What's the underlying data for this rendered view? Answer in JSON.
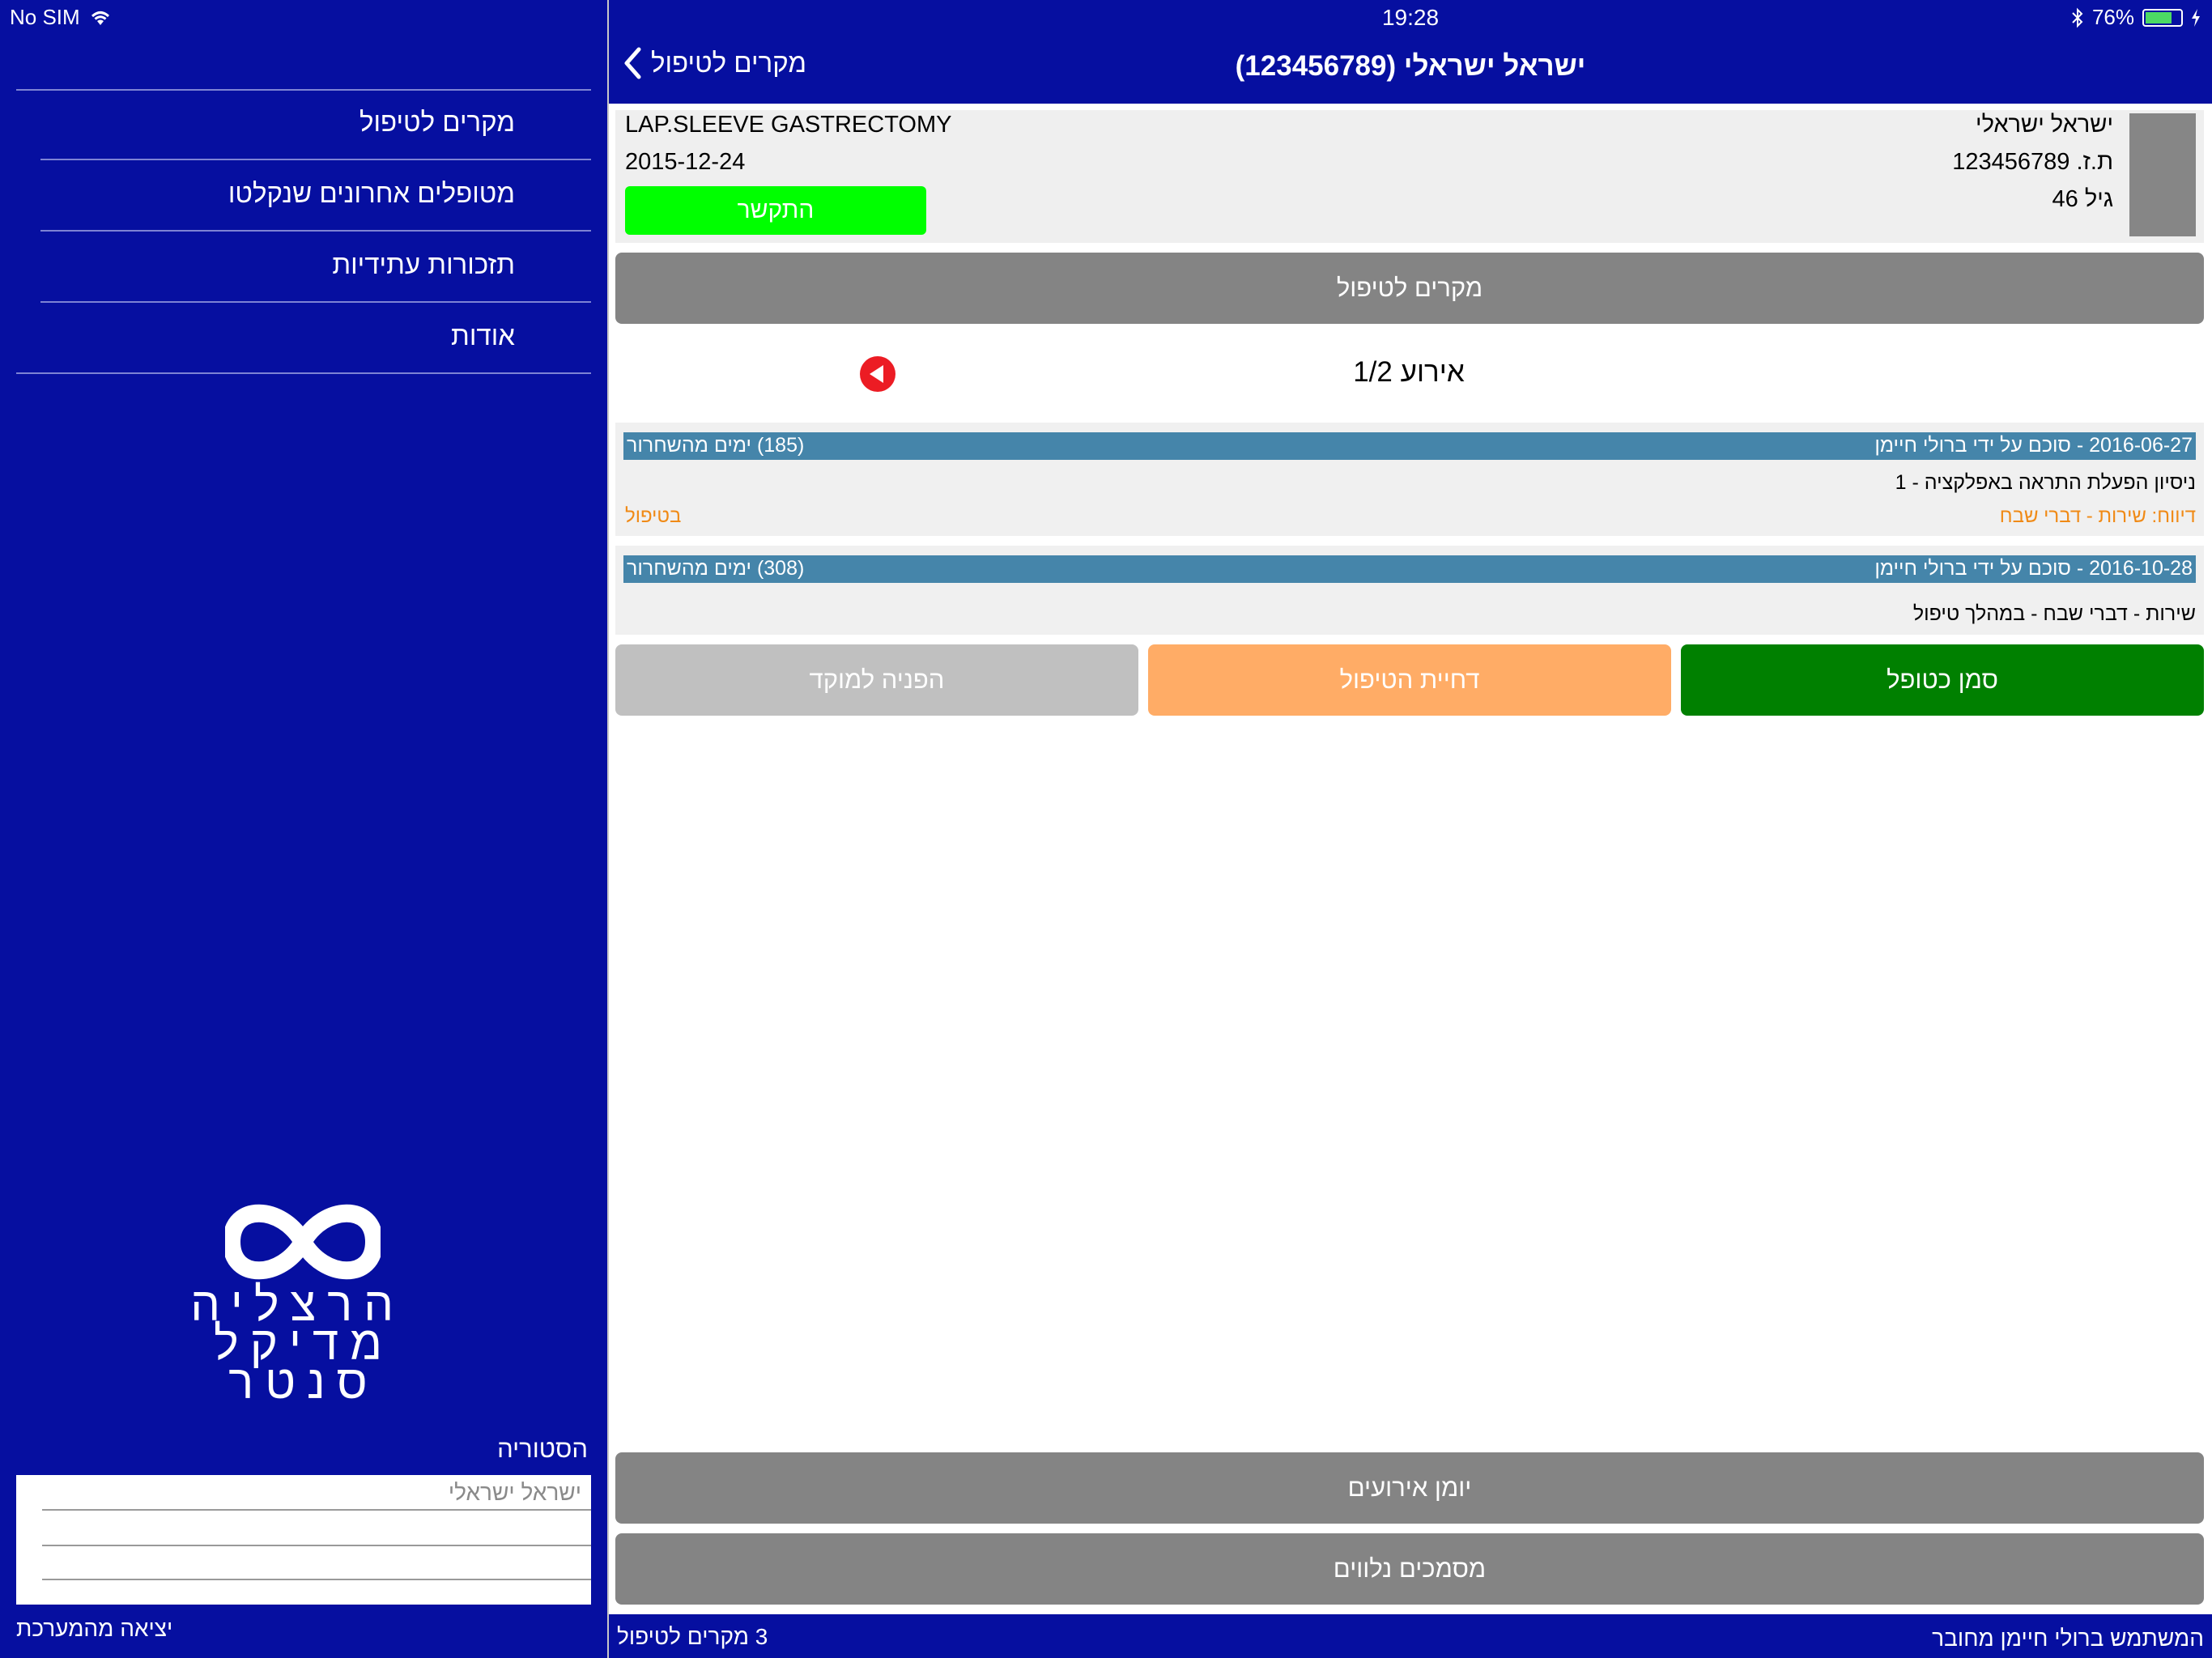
{
  "status_bar": {
    "carrier": "No SIM",
    "time": "19:28",
    "battery": "76%",
    "battery_level": 0.76
  },
  "sidebar": {
    "menu": [
      {
        "label": "מקרים לטיפול"
      },
      {
        "label": "מטופלים אחרונים שנקלטו"
      },
      {
        "label": "תזכורות עתידיות"
      },
      {
        "label": "אודות"
      }
    ],
    "logo_lines": [
      "הרצליה",
      "מדיקל",
      "סנטר"
    ],
    "history_title": "הסטוריה",
    "history_items": [
      "ישראל ישראלי"
    ],
    "logout": "יציאה מהמערכת"
  },
  "header": {
    "back_label": "מקרים לטיפול",
    "title": "ישראל ישראלי (123456789)"
  },
  "patient": {
    "name": "ישראל ישראלי",
    "id_line": "ת.ז. 123456789",
    "age_line": "גיל 46",
    "procedure": "LAP.SLEEVE GASTRECTOMY",
    "date": "2015-12-24",
    "contact_label": "התקשר"
  },
  "cases_button": "מקרים לטיפול",
  "pager": {
    "label": "אירוע 1/2"
  },
  "events": [
    {
      "header_right": "2016-06-27 - סוכם על ידי  ברולי חיימן",
      "header_left": "(185) ימים מהשחרור",
      "description": "ניסיון הפעלת התראה באפלקציה - 1",
      "note": "דיווח: שירות - דברי שבח",
      "status": "בטיפול"
    },
    {
      "header_right": "2016-10-28 - סוכם על ידי  ברולי חיימן",
      "header_left": "(308) ימים מהשחרור",
      "description": "שירות - דברי שבח - במהלך טיפול"
    }
  ],
  "actions": {
    "mark": "סמן כטופל",
    "postpone": "דחיית הטיפול",
    "refer": "הפניה למוקד"
  },
  "bottom_buttons": {
    "journal": "יומן אירועים",
    "documents": "מסמכים נלווים"
  },
  "footer": {
    "count": "3 מקרים לטיפול",
    "user": "המשתמש ברולי חיימן מחובר"
  },
  "colors": {
    "brand_blue": "#060fa0",
    "event_bar": "#4585aa",
    "contact_green": "#00ff00",
    "mark_green": "#008000",
    "postpone_orange": "#ffac66",
    "refer_gray": "#c0c0c0",
    "note_orange": "#f08a16",
    "pager_red": "#ec1c24"
  }
}
